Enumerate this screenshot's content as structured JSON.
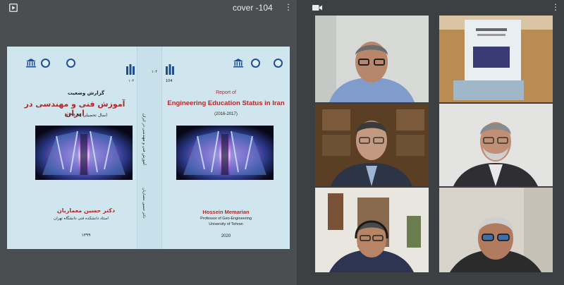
{
  "presentation": {
    "title": "cover -104",
    "icon": "present-icon",
    "more_icon": "more-vert-icon",
    "more_glyph": "⋮"
  },
  "cover_fa": {
    "number": "۱۰۴",
    "subtitle": "گزارش وضعیت",
    "title": "آموزش فنی و مهندسی در ایران",
    "years": "(سال تحصیلی ۹۵-۱۳۹۶)",
    "author": "دکتر حسین معماریان",
    "affiliation": "استاد دانشکده فنی دانشگاه تهران",
    "year": "۱۳۹۹"
  },
  "cover_en": {
    "number": "104",
    "number_right": "۱۰۴",
    "report_of": "Report of",
    "title": "Engineering Education Status in Iran",
    "years": "(2016-2017)",
    "author": "Hossein Memarian",
    "role": "Professor of Geo-Engineering",
    "university": "University of Tehran",
    "year": "2020"
  },
  "spine": {
    "title": "آموزش فنی و مهندسی در ایران",
    "author": "دکتر حسین معماریان"
  },
  "video": {
    "icon": "videocam-icon",
    "more_glyph": "⋮",
    "tiles": [
      {
        "name": "participant-1"
      },
      {
        "name": "participant-2"
      },
      {
        "name": "participant-3"
      },
      {
        "name": "participant-4"
      },
      {
        "name": "participant-5"
      },
      {
        "name": "participant-6"
      }
    ]
  },
  "colors": {
    "background": "#3c4043",
    "cover_bg": "#cfe6ef",
    "title_blue": "#1f5a9e",
    "accent_red": "#b02a2a"
  }
}
